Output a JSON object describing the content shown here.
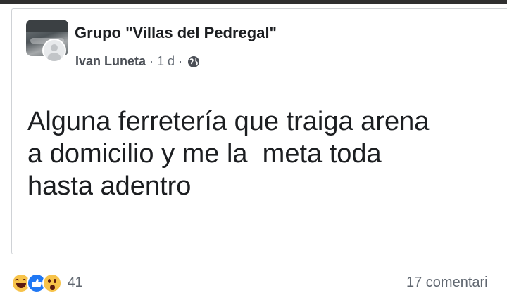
{
  "post": {
    "group_name": "Grupo \"Villas del Pedregal\"",
    "author": "Ivan Luneta",
    "separator": "·",
    "time": "1 d",
    "privacy_icon": "globe-icon",
    "text_lines": [
      "Alguna ferretería que traiga arena",
      "a domicilio y me la  meta toda",
      "hasta adentro"
    ]
  },
  "engagement": {
    "reaction_icons": [
      "haha-reaction-icon",
      "like-reaction-icon",
      "wow-reaction-icon"
    ],
    "reaction_count": "41",
    "comments_label": "17 comentari"
  },
  "colors": {
    "like": "#2078f4",
    "haha_wow": "#f7c34a",
    "meta_text": "#606770",
    "primary_text": "#1c1e21"
  }
}
